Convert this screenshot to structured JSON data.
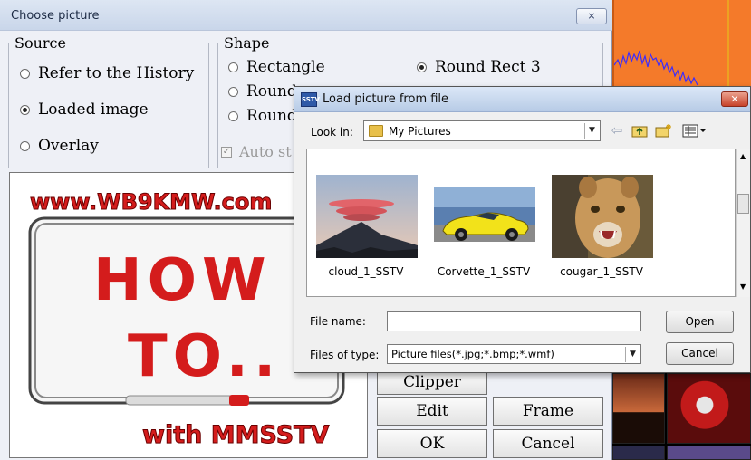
{
  "choose_dialog": {
    "title": "Choose picture",
    "close_glyph": "⨯",
    "source": {
      "legend": "Source",
      "options": [
        {
          "label": "Refer to the History",
          "checked": false
        },
        {
          "label": "Loaded image",
          "checked": true
        },
        {
          "label": "Overlay",
          "checked": false
        }
      ]
    },
    "shape": {
      "legend": "Shape",
      "options": [
        {
          "label": "Rectangle",
          "checked": false
        },
        {
          "label": "Round Rect 3",
          "checked": true
        },
        {
          "label": "Round",
          "checked": false
        },
        {
          "label": "Round",
          "checked": false
        }
      ],
      "auto_checkbox_label": "Auto st",
      "auto_checked": true
    },
    "preview": {
      "url_text": "www.WB9KMW.com",
      "how_text": "HOW",
      "to_text": "TO..",
      "footer_text": "with MMSSTV"
    },
    "buttons": {
      "clipper": "Clipper",
      "edit": "Edit",
      "frame": "Frame",
      "ok": "OK",
      "cancel": "Cancel"
    }
  },
  "load_dialog": {
    "title": "Load picture from file",
    "title_icon_text": "SSTV",
    "close_glyph": "✕",
    "look_in_label": "Look in:",
    "look_in_value": "My Pictures",
    "toolbar_icons": [
      "back-icon",
      "up-folder-icon",
      "new-folder-icon",
      "view-menu-icon"
    ],
    "files": [
      {
        "name": "cloud_1_SSTV",
        "thumb": "mountain-cloud"
      },
      {
        "name": "Corvette_1_SSTV",
        "thumb": "yellow-car"
      },
      {
        "name": "cougar_1_SSTV",
        "thumb": "cougar"
      }
    ],
    "file_name_label": "File name:",
    "file_name_value": "",
    "files_of_type_label": "Files of type:",
    "files_of_type_value": "Picture files(*.jpg;*.bmp;*.wmf)",
    "open_button": "Open",
    "cancel_button": "Cancel"
  },
  "colors": {
    "preview_red": "#d41c1c",
    "spectrum_orange": "#f47a2a",
    "spectrum_trace": "#3a2cff",
    "titlebar_blue": "#b7cbe6"
  }
}
